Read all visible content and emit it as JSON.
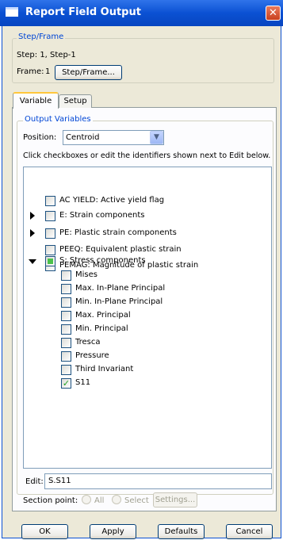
{
  "window": {
    "title": "Report Field Output",
    "close_glyph": "✕",
    "icon": "window-icon"
  },
  "step_frame": {
    "legend": "Step/Frame",
    "step_text": "Step: 1, Step-1",
    "frame_label": "Frame:",
    "frame_value": "1",
    "button_label": "Step/Frame..."
  },
  "tabs": [
    {
      "label": "Variable",
      "active": true
    },
    {
      "label": "Setup",
      "active": false
    }
  ],
  "output_variables": {
    "legend": "Output Variables",
    "position_label": "Position:",
    "position_value": "Centroid",
    "instruction": "Click checkboxes or edit the identifiers shown next to Edit below.",
    "tree": [
      {
        "label": "AC YIELD: Active yield flag",
        "expander": "none",
        "state": "unchecked"
      },
      {
        "label": "E: Strain components",
        "expander": "collapsed",
        "state": "unchecked"
      },
      {
        "label": "PE: Plastic strain components",
        "expander": "collapsed",
        "state": "unchecked"
      },
      {
        "label": "PEEQ: Equivalent plastic strain",
        "expander": "none",
        "state": "unchecked"
      },
      {
        "label": "PEMAG: Magnitude of plastic strain",
        "expander": "none",
        "state": "unchecked"
      },
      {
        "label": "S: Stress components",
        "expander": "expanded",
        "state": "partial"
      }
    ],
    "children": [
      {
        "label": "Mises",
        "checked": false
      },
      {
        "label": "Max. In-Plane Principal",
        "checked": false
      },
      {
        "label": "Min. In-Plane Principal",
        "checked": false
      },
      {
        "label": "Max. Principal",
        "checked": false
      },
      {
        "label": "Min. Principal",
        "checked": false
      },
      {
        "label": "Tresca",
        "checked": false
      },
      {
        "label": "Pressure",
        "checked": false
      },
      {
        "label": "Third Invariant",
        "checked": false
      },
      {
        "label": "S11",
        "checked": true
      }
    ],
    "edit_label": "Edit:",
    "edit_value": "S.S11",
    "section_point_label": "Section point:",
    "radio_all": "All",
    "radio_select": "Select",
    "settings_label": "Settings..."
  },
  "footer": {
    "ok": "OK",
    "apply": "Apply",
    "defaults": "Defaults",
    "cancel": "Cancel"
  },
  "colors": {
    "title_bar": "#0b51d3",
    "legend_text": "#0046d5",
    "dialog_bg": "#ece9d8",
    "check_green": "#21a121"
  }
}
